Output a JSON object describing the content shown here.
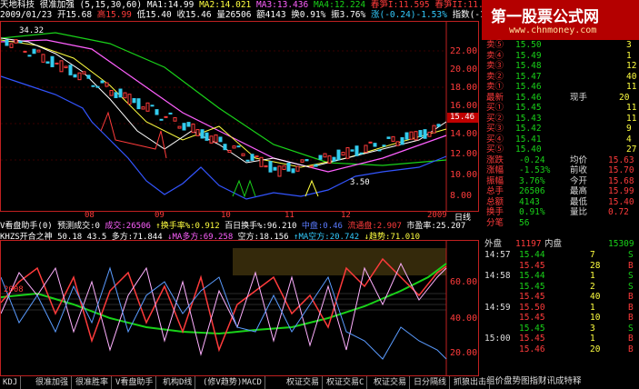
{
  "header": {
    "stock_name": "天地科技",
    "indicator": "很准加强 (5,15,30,60)",
    "ma1": "MA1:14.99",
    "ma2": "MA2:14.021",
    "ma3": "MA3:13.436",
    "ma4": "MA4:12.224",
    "tag1": "春笋I:11.595",
    "tag2": "春笋II:11.595",
    "tag3": "春笋",
    "date": "2009/01/23",
    "open": "开15.68",
    "high": "高15.99",
    "low": "低15.40",
    "close": "收15.46",
    "volume": "量26506",
    "amount": "额4143",
    "turnover": "换0.91%",
    "amplitude": "振3.76%",
    "change": "涨(-0.24)-1.53%",
    "index": "指数(-14.29)"
  },
  "main_chart": {
    "price_axis": [
      "22.00",
      "20.00",
      "18.00",
      "16.00",
      "14.00",
      "12.00",
      "10.00",
      "8.00"
    ],
    "corner_label": "34.32",
    "current_price": "15.46",
    "low_marker": "3.50",
    "month_labels": [
      "08",
      "09",
      "10",
      "11",
      "12",
      "2009"
    ],
    "period_label": "日线"
  },
  "sub_chart": {
    "line1": "V看盘助手(0) 预测成交:0",
    "cj": "成交:26506",
    "hsl": "↑换手率%:0.912",
    "bh": "百日换手%:96.210",
    "sp": "中盘:0.46",
    "lt": "流通盘:2.907",
    "syl": "市盈率:25.207",
    "line2": "KHZS开合之神 50.18 43.5",
    "dq": "多方:71.844",
    "madq": "↓MA多方:69.258",
    "kf": "空方:18.156",
    "makf": "↑MA空方:20.742",
    "qs": "↓趋势:71.010",
    "axis": [
      "60.00",
      "40.00",
      "20.00"
    ],
    "month_labels": [
      "2008",
      "08",
      "09",
      "10",
      "11",
      "12",
      "2009"
    ]
  },
  "order_book": {
    "sells": [
      {
        "label": "卖⑤",
        "price": "15.50",
        "vol": "3"
      },
      {
        "label": "卖④",
        "price": "15.49",
        "vol": "1"
      },
      {
        "label": "卖③",
        "price": "15.48",
        "vol": "12"
      },
      {
        "label": "卖②",
        "price": "15.47",
        "vol": "40"
      },
      {
        "label": "卖①",
        "price": "15.46",
        "vol": "11"
      }
    ],
    "latest_label": "最新",
    "latest_price": "15.46",
    "latest_sub": "现手",
    "latest_vol": "20",
    "buys": [
      {
        "label": "买①",
        "price": "15.45",
        "vol": "11"
      },
      {
        "label": "买②",
        "price": "15.43",
        "vol": "11"
      },
      {
        "label": "买③",
        "price": "15.42",
        "vol": "9"
      },
      {
        "label": "买④",
        "price": "15.41",
        "vol": "4"
      },
      {
        "label": "买⑤",
        "price": "15.40",
        "vol": "27"
      }
    ],
    "stats": [
      {
        "l1": "涨跌",
        "v1": "-0.24",
        "l2": "均价",
        "v2": "15.63"
      },
      {
        "l1": "涨幅",
        "v1": "-1.53%",
        "l2": "前收",
        "v2": "15.70"
      },
      {
        "l1": "振幅",
        "v1": "3.76%",
        "l2": "今开",
        "v2": "15.68"
      },
      {
        "l1": "总手",
        "v1": "26506",
        "l2": "最高",
        "v2": "15.99"
      },
      {
        "l1": "总额",
        "v1": "4143",
        "l2": "最低",
        "v2": "15.40"
      },
      {
        "l1": "换手",
        "v1": "0.91%",
        "l2": "量比",
        "v2": "0.72"
      },
      {
        "l1": "分笔",
        "v1": "56",
        "l2": "",
        "v2": ""
      }
    ],
    "outer_label": "外盘",
    "outer": "11197",
    "inner_label": "内盘",
    "inner": "15309",
    "ticks": [
      {
        "t": "14:57",
        "p": "15.44",
        "v": "7",
        "d": "S"
      },
      {
        "t": "",
        "p": "15.45",
        "v": "28",
        "d": "B"
      },
      {
        "t": "14:58",
        "p": "15.44",
        "v": "1",
        "d": "S"
      },
      {
        "t": "",
        "p": "15.45",
        "v": "2",
        "d": "S"
      },
      {
        "t": "",
        "p": "15.45",
        "v": "40",
        "d": "B"
      },
      {
        "t": "14:59",
        "p": "15.50",
        "v": "1",
        "d": "B"
      },
      {
        "t": "",
        "p": "15.45",
        "v": "10",
        "d": "B"
      },
      {
        "t": "",
        "p": "15.45",
        "v": "3",
        "d": "S"
      },
      {
        "t": "15:00",
        "p": "15.45",
        "v": "1",
        "d": "B"
      },
      {
        "t": "",
        "p": "15.46",
        "v": "20",
        "d": "B"
      }
    ],
    "footer": "组价盘势图指财讯成特释"
  },
  "watermark": {
    "line1": "第一股票公式网",
    "line2": "www.chnmoney.com"
  },
  "tabs": [
    "KDJ",
    "很准加强",
    "很准胜率",
    "V看盘助手",
    "机构D线",
    "(修V趋势)MACD",
    "权证交易",
    "权证交易C",
    "权证交易",
    "日分隔线",
    "抓狼出击"
  ]
}
